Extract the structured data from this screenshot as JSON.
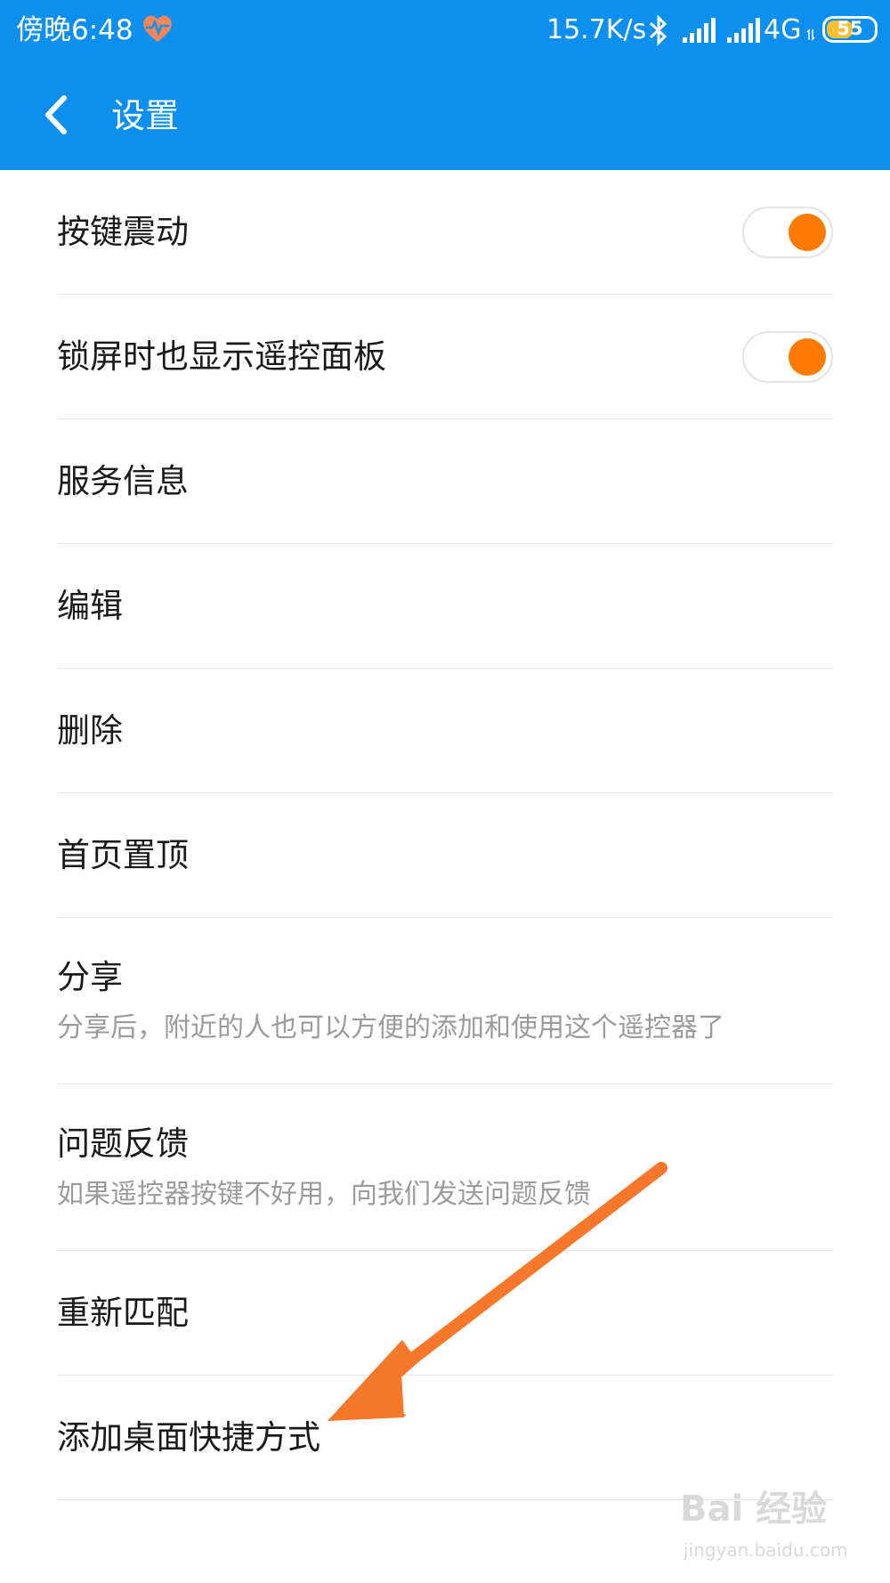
{
  "status_bar": {
    "time": "傍晚6:48",
    "speed": "15.7K/s",
    "network": "4G",
    "battery": "55",
    "battery_level_percent": 55,
    "heart_color": "#f0865a"
  },
  "nav": {
    "back_icon": "chevron-left-icon",
    "title": "设置",
    "background_color": "#0d8fef"
  },
  "settings": {
    "key_vibration": {
      "label": "按键震动",
      "enabled": true
    },
    "lockscreen_panel": {
      "label": "锁屏时也显示遥控面板",
      "enabled": true
    },
    "service_info": {
      "label": "服务信息"
    },
    "edit": {
      "label": "编辑"
    },
    "delete": {
      "label": "删除"
    },
    "pin_top": {
      "label": "首页置顶"
    },
    "share": {
      "label": "分享",
      "description": "分享后，附近的人也可以方便的添加和使用这个遥控器了"
    },
    "feedback": {
      "label": "问题反馈",
      "description": "如果遥控器按键不好用，向我们发送问题反馈"
    },
    "rematch": {
      "label": "重新匹配"
    },
    "add_shortcut": {
      "label": "添加桌面快捷方式"
    }
  },
  "accent_colors": {
    "toggle_on": "#ff7a00",
    "annotation_arrow": "#f7782a"
  },
  "watermark": {
    "brand": "Bai 经验",
    "url": "jingyan.baidu.com"
  }
}
